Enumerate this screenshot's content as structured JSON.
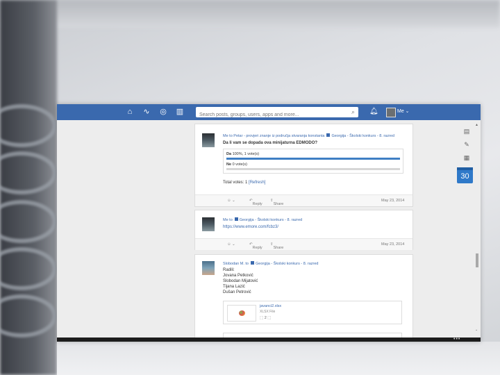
{
  "topbar": {
    "search_placeholder": "Search posts, groups, users, apps and more...",
    "me_label": "Me"
  },
  "icons": {
    "home": "home-icon",
    "activity": "activity-icon",
    "discover": "compass-icon",
    "library": "book-icon",
    "notifications": "bell-icon"
  },
  "posts": [
    {
      "header": "Me to Petar - provjeri znanje iz područja stvaranja konstanta",
      "group": "Georgija - Školski konkurs - 8. razred",
      "question": "Da li vam se dopada ova minijaturna EDMODO?",
      "poll": [
        {
          "label": "Da",
          "result": "100%, 1 vote(s)",
          "fraction": 1.0
        },
        {
          "label": "Ne",
          "result": "0 vote(s)",
          "fraction": 0.0
        }
      ],
      "total_votes": "Total votes: 1",
      "refresh": "[Refresh]",
      "reply": "Reply",
      "share": "Share",
      "date": "May 23, 2014"
    },
    {
      "header": "Me to",
      "group": "Georgija - Školski konkurs - 8. razred",
      "link": "https://www.emore.com/fcbz3/",
      "reply": "Reply",
      "share": "Share",
      "date": "May 23, 2014"
    },
    {
      "header": "Slobodan M. to",
      "group": "Georgija - Školski konkurs - 8. razred",
      "lines": [
        "Radili:",
        "Jovana Petković",
        "Slobodan Mijatović",
        "Tijana Lazić",
        "Dušan Petrović"
      ],
      "attachment": {
        "name": "javanci2.xlsx",
        "type": "XLSX File",
        "icons": "⬚ 2 ⬚"
      }
    }
  ],
  "sidebar_right": {
    "calendar_day": "30"
  },
  "colors": {
    "brand": "#3a69ae",
    "accent": "#2f79c9"
  }
}
